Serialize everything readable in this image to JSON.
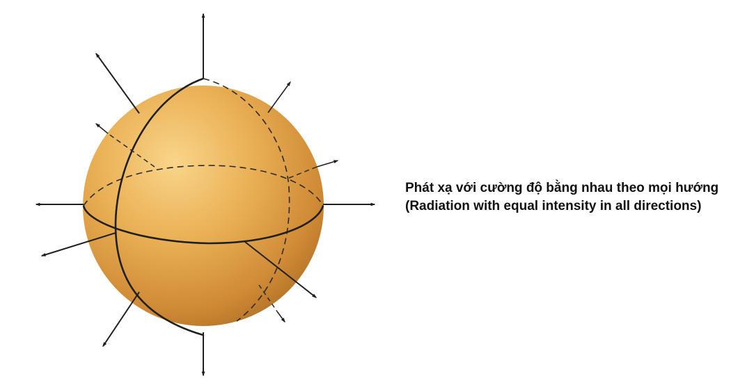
{
  "caption": "Phát xạ với cường độ bằng nhau theo mọi hướng (Radiation with equal intensity in all directions)",
  "colors": {
    "sphere_light": "#f7cf80",
    "sphere_mid": "#e6a648",
    "sphere_dark": "#b26f22",
    "line": "#1f1f1f"
  }
}
